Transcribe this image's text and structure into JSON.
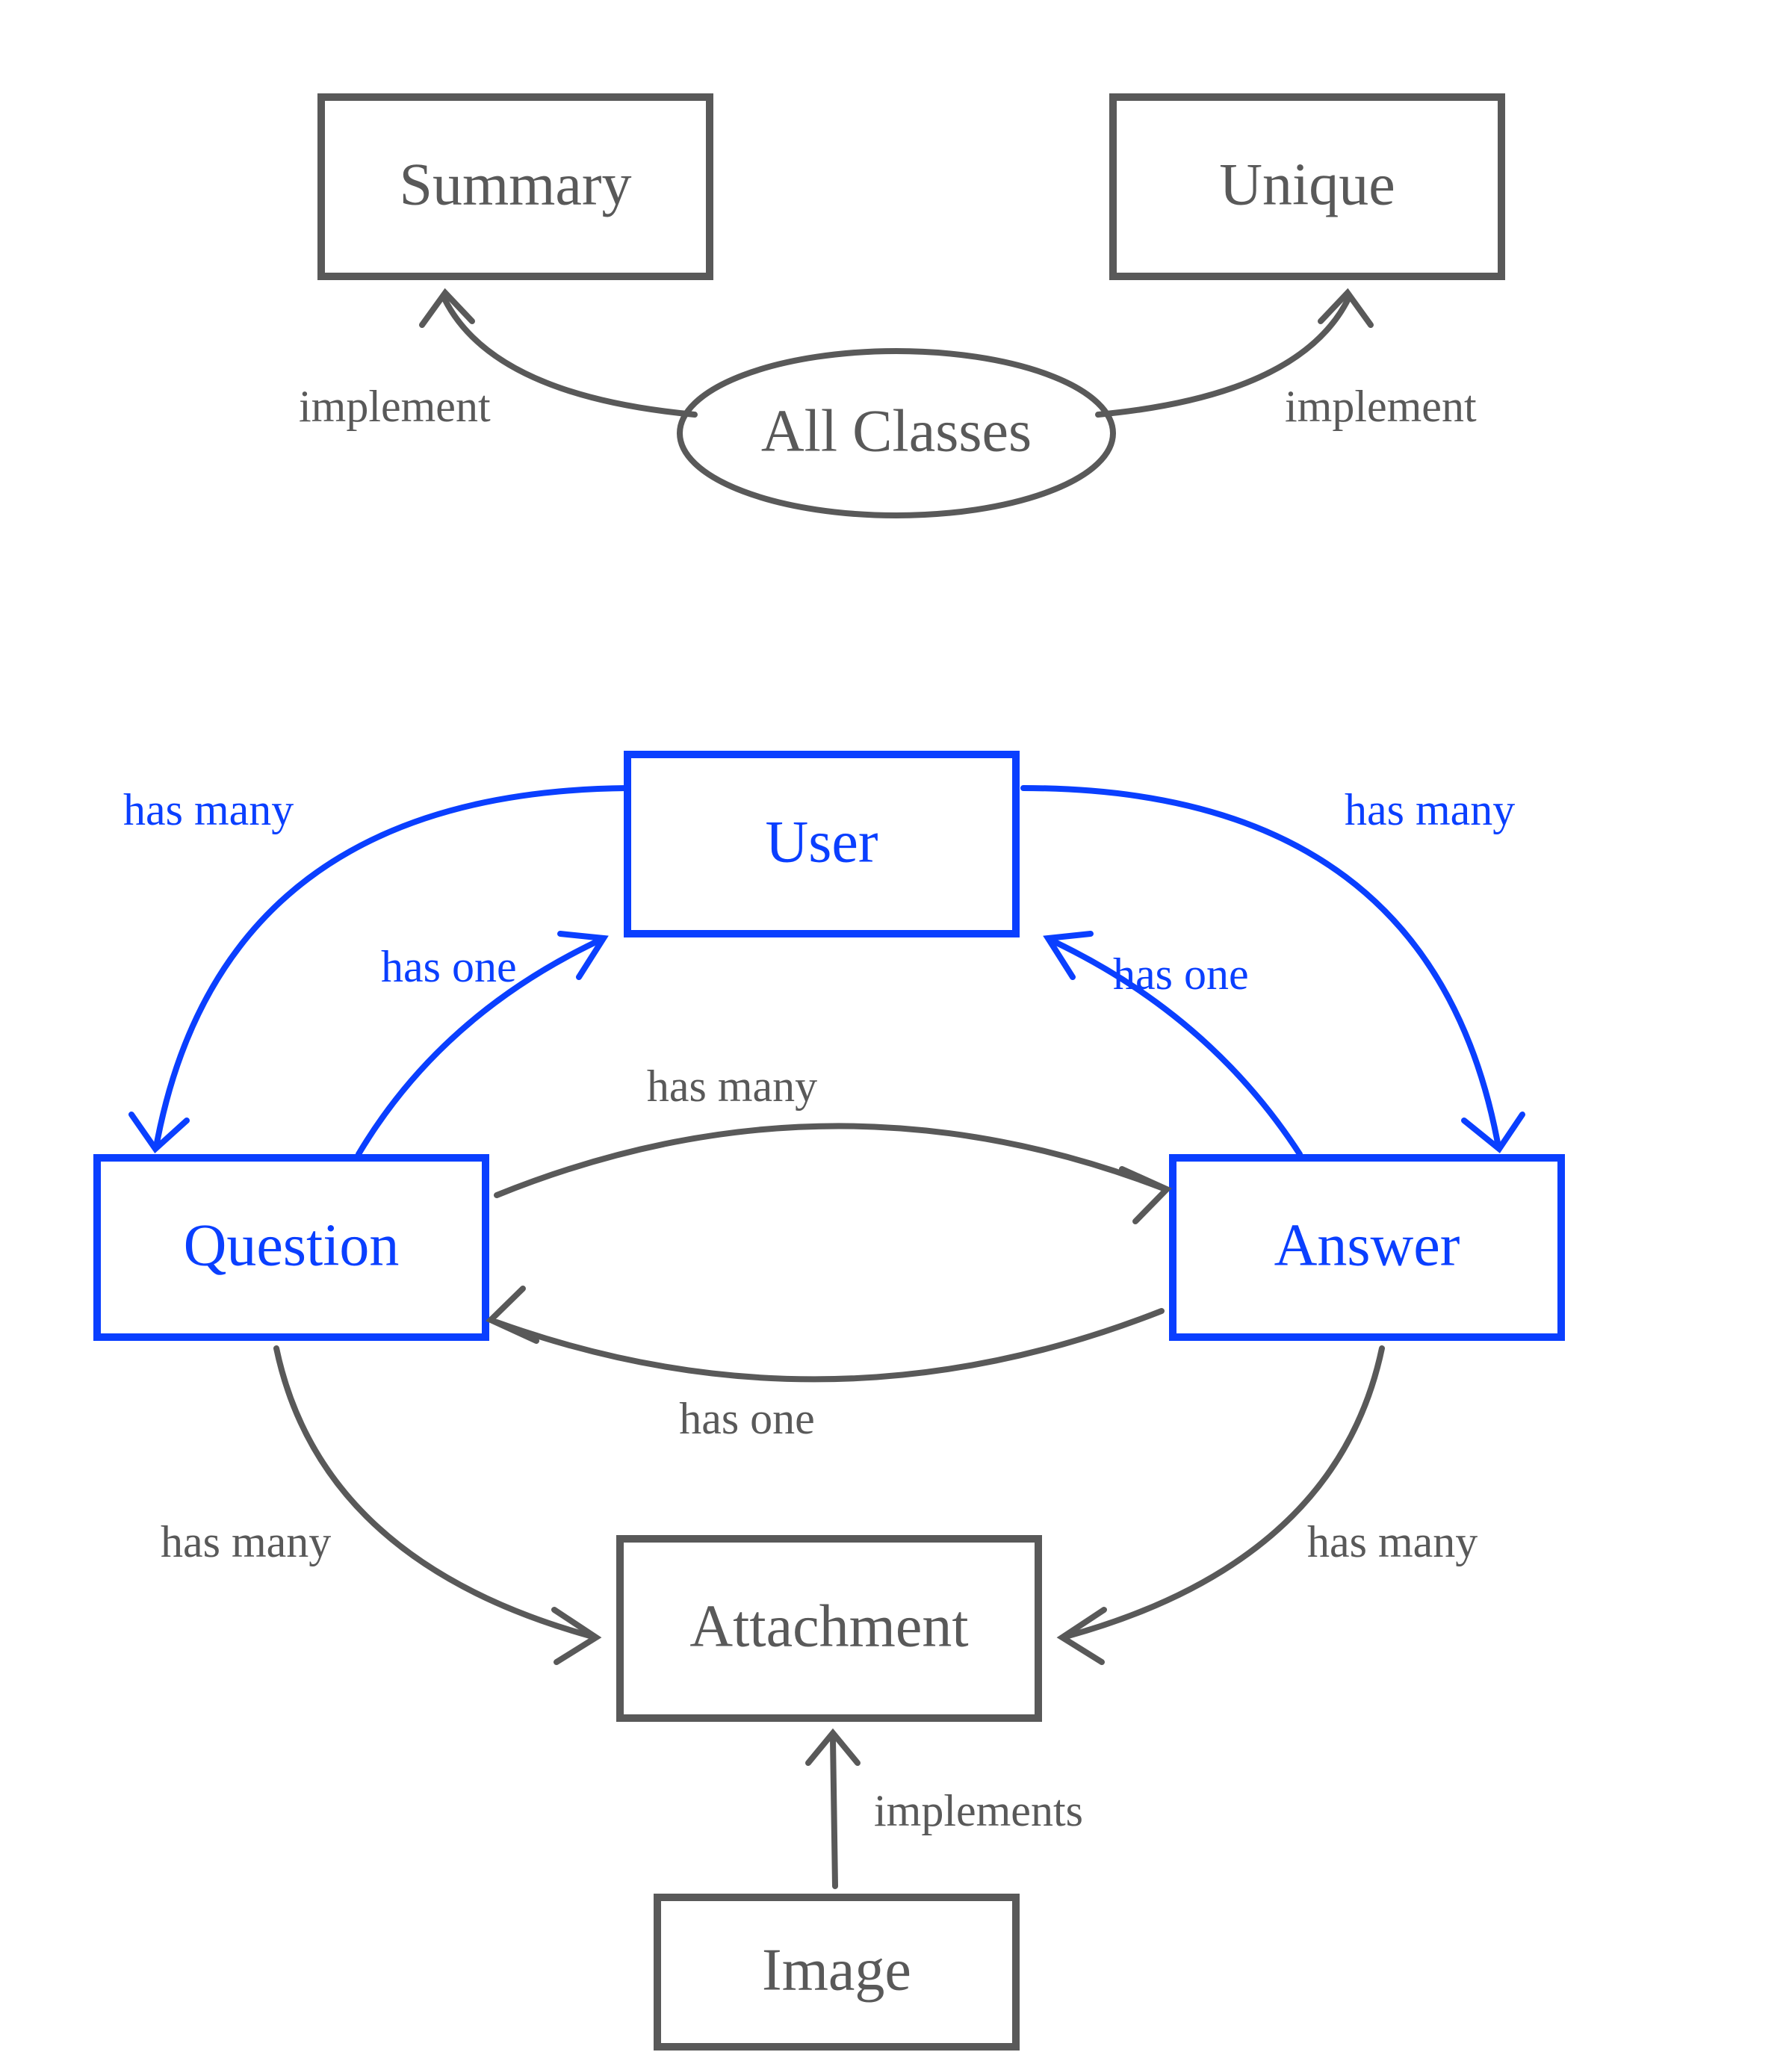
{
  "nodes": {
    "summary": {
      "label": "Summary"
    },
    "unique": {
      "label": "Unique"
    },
    "allclasses": {
      "label": "All Classes"
    },
    "user": {
      "label": "User"
    },
    "question": {
      "label": "Question"
    },
    "answer": {
      "label": "Answer"
    },
    "attachment": {
      "label": "Attachment"
    },
    "image": {
      "label": "Image"
    }
  },
  "edges": {
    "ac_summary": {
      "label": "implement"
    },
    "ac_unique": {
      "label": "implement"
    },
    "user_q_many": {
      "label": "has many"
    },
    "q_user_one": {
      "label": "has one"
    },
    "user_a_many": {
      "label": "has many"
    },
    "a_user_one": {
      "label": "has one"
    },
    "q_a_many": {
      "label": "has many"
    },
    "a_q_one": {
      "label": "has one"
    },
    "q_att_many": {
      "label": "has many"
    },
    "a_att_many": {
      "label": "has many"
    },
    "img_att_impl": {
      "label": "implements"
    }
  },
  "colors": {
    "gray": "#595959",
    "blue": "#0a3fff"
  }
}
